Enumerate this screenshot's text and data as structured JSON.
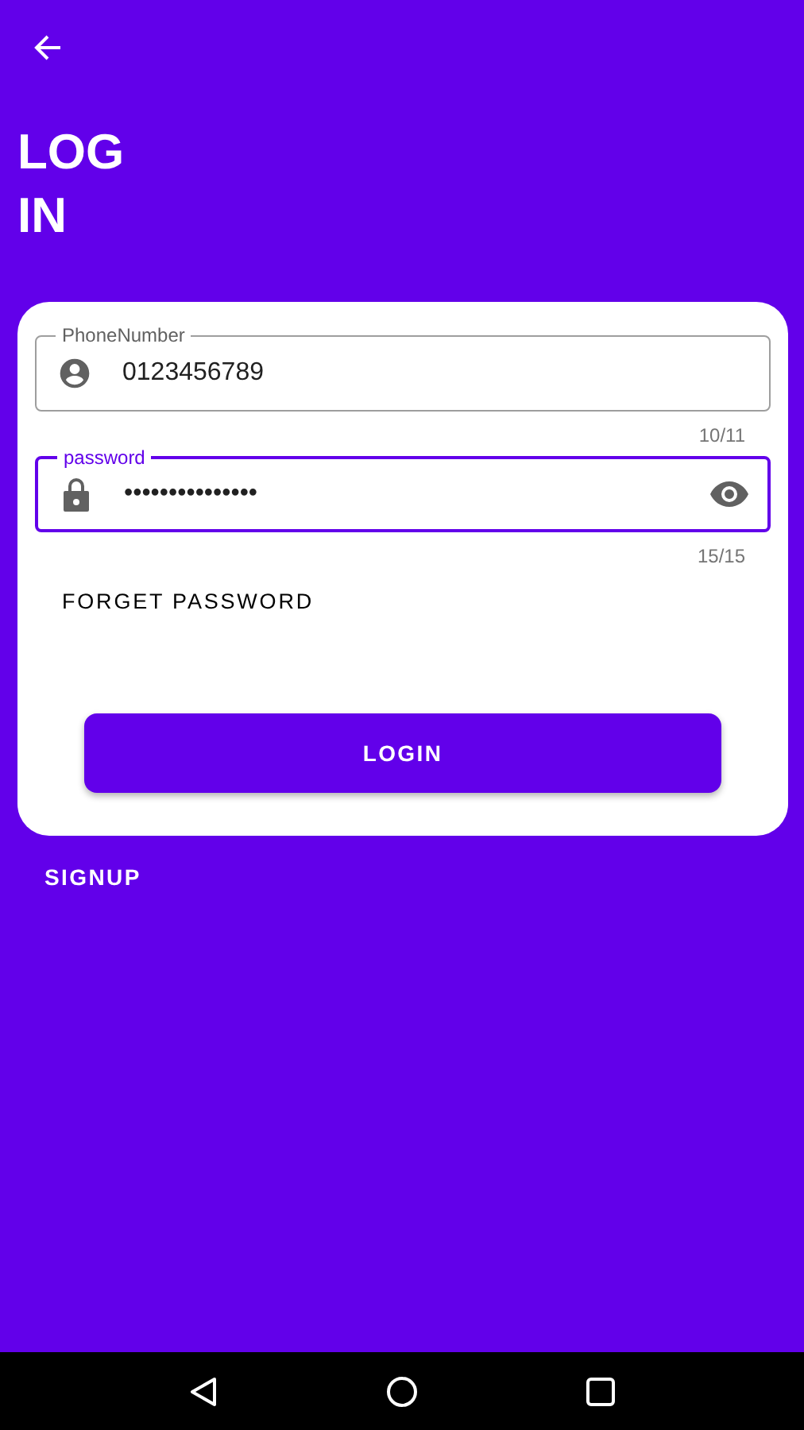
{
  "title": "LOG IN",
  "fields": [
    {
      "kind": "person",
      "label": "PhoneNumber",
      "value": "0123456789",
      "counter": "10/11",
      "focused": false,
      "visibility_toggle": false
    },
    {
      "kind": "lock",
      "label": "password",
      "value": "•••••••••••••••",
      "counter": "15/15",
      "focused": true,
      "visibility_toggle": true
    }
  ],
  "forgot_link": "FORGET PASSWORD",
  "login_button": "LOGIN",
  "signup_link": "SIGNUP"
}
